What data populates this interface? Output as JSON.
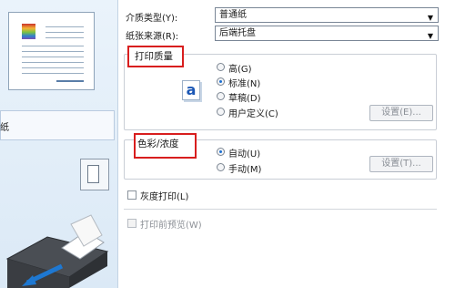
{
  "settings": {
    "media_type": {
      "label": "介质类型(Y):",
      "value": "普通纸"
    },
    "paper_source": {
      "label": "纸张来源(R):",
      "value": "后端托盘"
    },
    "print_quality": {
      "title": "打印质量",
      "options": [
        {
          "label": "高(G)",
          "checked": false
        },
        {
          "label": "标准(N)",
          "checked": true
        },
        {
          "label": "草稿(D)",
          "checked": false
        },
        {
          "label": "用户定义(C)",
          "checked": false
        }
      ],
      "set_button": "设置(E)...",
      "icon_letter": "a"
    },
    "color_intensity": {
      "title": "色彩/浓度",
      "options": [
        {
          "label": "自动(U)",
          "checked": true
        },
        {
          "label": "手动(M)",
          "checked": false
        }
      ],
      "set_button": "设置(T)..."
    },
    "grayscale": {
      "label": "灰度打印(L)",
      "checked": false
    },
    "preview": {
      "label": "打印前预览(W)",
      "checked": false
    }
  },
  "left_panel": {
    "paper_source_text": "纸"
  },
  "icons": {
    "dropdown_arrow": "▼"
  },
  "colors": {
    "highlight_red": "#d81e1e",
    "radio_selected": "#1c6fd0",
    "printer_arrow": "#1e78d2"
  }
}
